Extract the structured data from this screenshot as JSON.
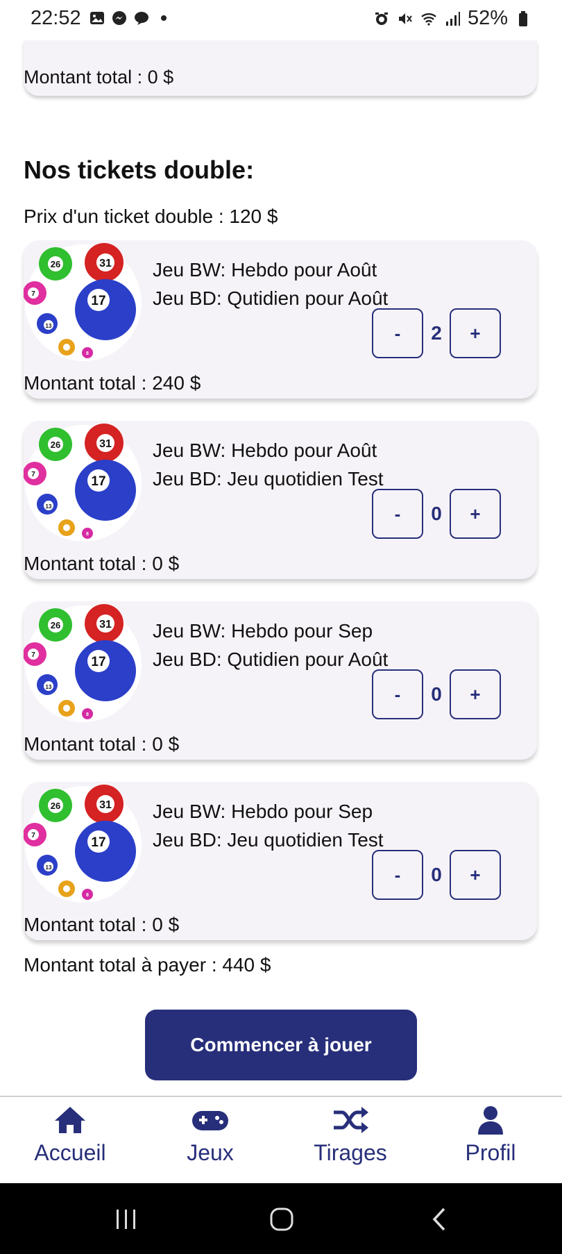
{
  "status_bar": {
    "time": "22:52",
    "battery": "52%",
    "icons": [
      "gallery-icon",
      "messenger-icon",
      "chat-icon",
      "dot-icon",
      "alarm-icon",
      "mute-icon",
      "wifi-icon",
      "signal-icon",
      "battery-icon"
    ]
  },
  "partial_card": {
    "total": "Montant total : 0 $"
  },
  "section": {
    "title": "Nos tickets double:",
    "price_line": "Prix d'un ticket double : 120 $"
  },
  "tickets": [
    {
      "line1": "Jeu BW: Hebdo pour Août",
      "line2": "Jeu BD: Qutidien pour Août",
      "quantity": "2",
      "total": "Montant total : 240 $"
    },
    {
      "line1": "Jeu BW: Hebdo pour Août",
      "line2": "Jeu BD: Jeu quotidien Test",
      "quantity": "0",
      "total": "Montant total : 0 $"
    },
    {
      "line1": "Jeu BW: Hebdo pour Sep",
      "line2": "Jeu BD: Qutidien pour Août",
      "quantity": "0",
      "total": "Montant total : 0 $"
    },
    {
      "line1": "Jeu BW: Hebdo pour Sep",
      "line2": "Jeu BD: Jeu quotidien Test",
      "quantity": "0",
      "total": "Montant total : 0 $"
    }
  ],
  "stepper": {
    "minus": "-",
    "plus": "+"
  },
  "lottery_balls": [
    "26",
    "31",
    "7",
    "17",
    "13",
    "8"
  ],
  "grand_total": "Montant total à payer : 440 $",
  "cta_label": "Commencer à jouer",
  "nav": [
    {
      "label": "Accueil",
      "icon": "home-icon"
    },
    {
      "label": "Jeux",
      "icon": "gamepad-icon"
    },
    {
      "label": "Tirages",
      "icon": "shuffle-icon"
    },
    {
      "label": "Profil",
      "icon": "user-icon"
    }
  ],
  "colors": {
    "primary": "#272f7a",
    "card_bg": "#f6f3f8",
    "system_nav_bg": "#000000"
  }
}
